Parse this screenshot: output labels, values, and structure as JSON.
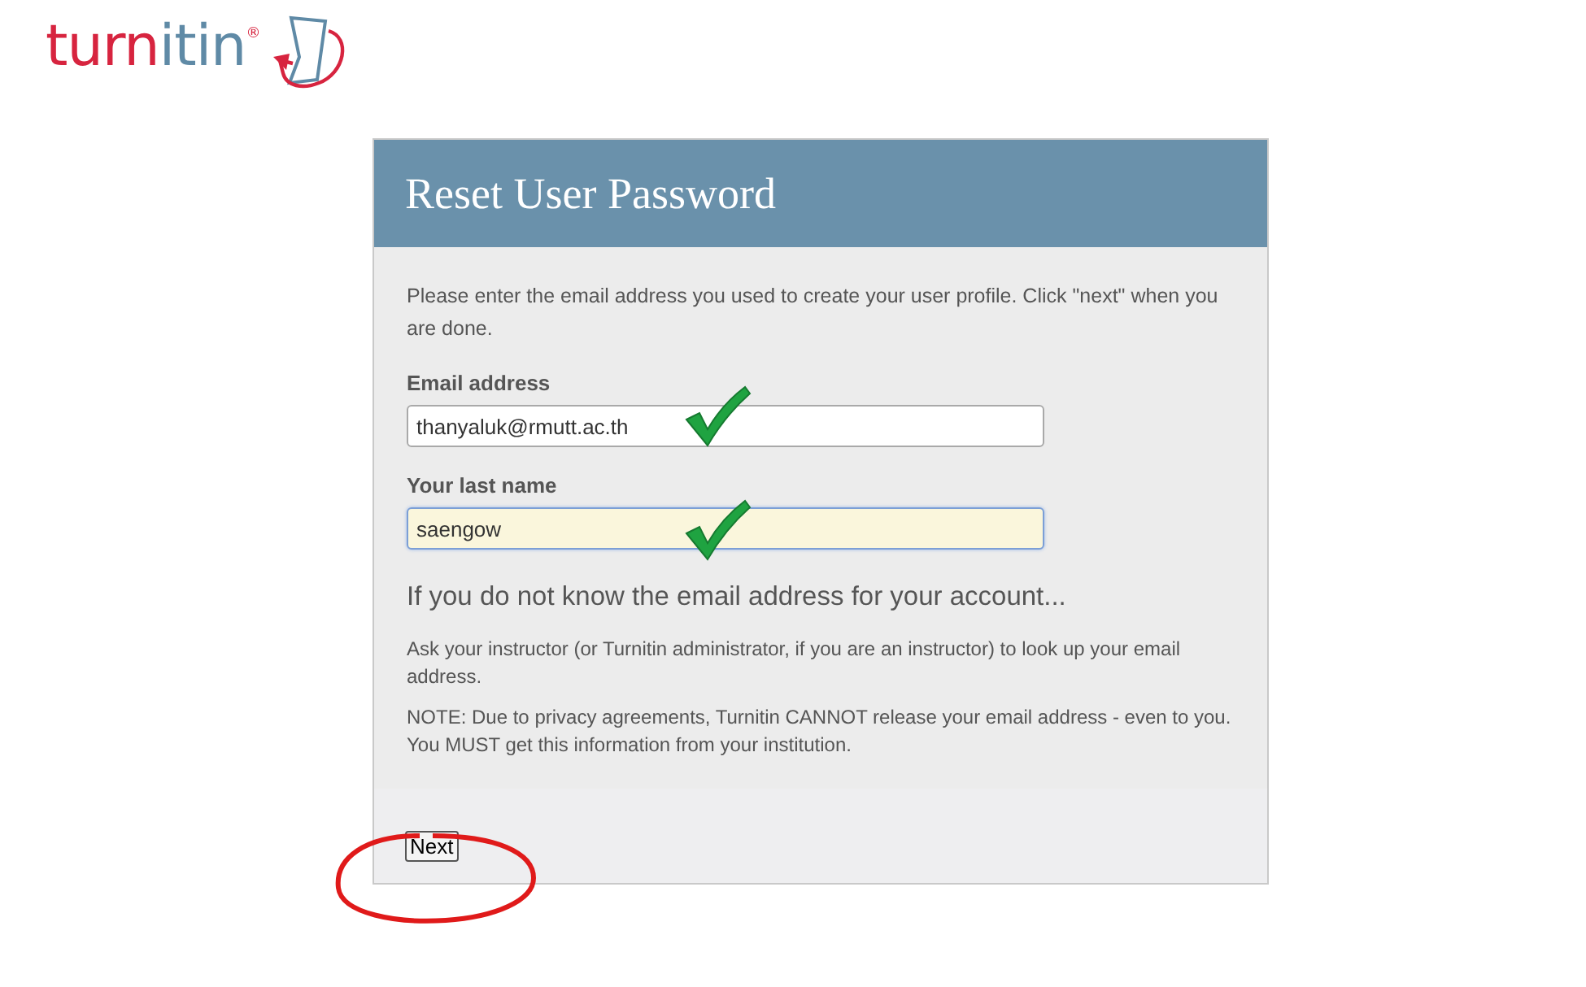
{
  "logo": {
    "parts": [
      {
        "text": "turn",
        "color": "#d7243f"
      },
      {
        "text": "itin",
        "color": "#5f8aa6"
      }
    ],
    "mark": "®"
  },
  "panel": {
    "title": "Reset User Password",
    "intro": "Please enter the email address you used to create your user profile. Click \"next\" when you are done.",
    "fields": [
      {
        "label": "Email address",
        "value": "thanyaluk@rmutt.ac.th",
        "focused": false
      },
      {
        "label": "Your last name",
        "value": "saengow",
        "focused": true
      }
    ],
    "help_heading": "If you do not know the email address for your account...",
    "help_paragraphs": [
      "Ask your instructor (or Turnitin administrator, if you are an instructor) to look up your email address.",
      "NOTE: Due to privacy agreements, Turnitin CANNOT release your email address - even to you. You MUST get this information from your institution."
    ],
    "button": "Next"
  }
}
